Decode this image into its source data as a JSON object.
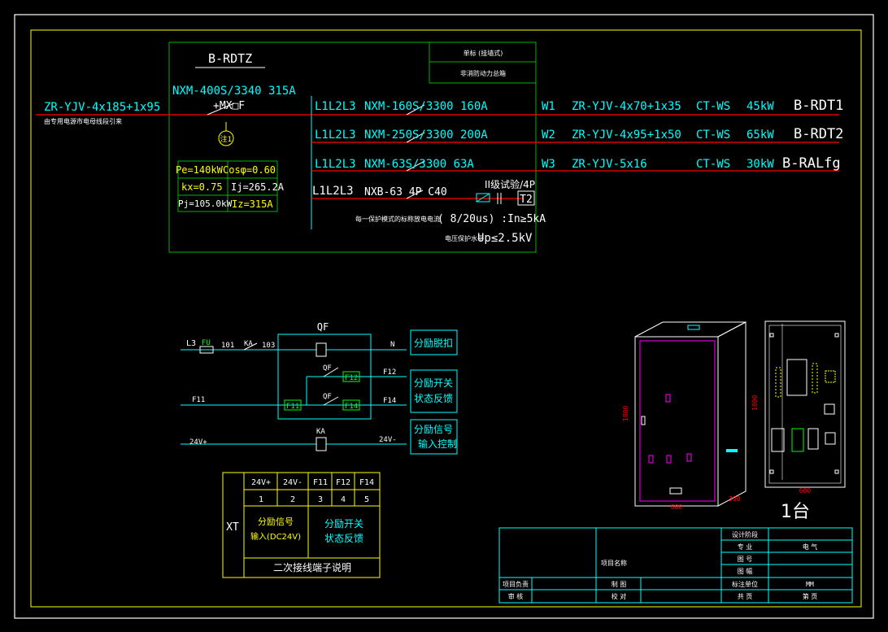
{
  "panel": {
    "name": "B-RDTZ",
    "mode_label1": "单标 (挂墙式)",
    "mode_label2": "非消防动力总箱"
  },
  "incoming": {
    "cable": "ZR-YJV-4x185+1x95",
    "source": "由专用电源市电母线段引来",
    "breaker": "NXM-400S/3340 315A",
    "shunt": "+MX□F",
    "note": "注1"
  },
  "calc": {
    "pe": "Pe=140kW",
    "cos": "Cosφ=0.60",
    "kx": "kx=0.75",
    "ij": "Ij=265.2A",
    "pj": "Pj=105.0kW",
    "iz": "Iz=315A"
  },
  "outgoing": [
    {
      "phase": "L1L2L3",
      "breaker": "NXM-160S/3300 160A",
      "circuit": "W1",
      "cable": "ZR-YJV-4x70+1x35",
      "lay": "CT-WS",
      "power": "45kW",
      "dest": "B-RDT1"
    },
    {
      "phase": "L1L2L3",
      "breaker": "NXM-250S/3300 200A",
      "circuit": "W2",
      "cable": "ZR-YJV-4x95+1x50",
      "lay": "CT-WS",
      "power": "65kW",
      "dest": "B-RDT2"
    },
    {
      "phase": "L1L2L3",
      "breaker": "NXM-63S/3300 63A",
      "circuit": "W3",
      "cable": "ZR-YJV-5x16",
      "lay": "CT-WS",
      "power": "30kW",
      "dest": "B-RALfg"
    }
  ],
  "spd": {
    "phase": "L1L2L3",
    "breaker": "NXB-63 4P C40",
    "class": "II级试验/4P",
    "tag": "T2",
    "line1_cn": "每一保护模式的标称放电电流",
    "line1": "( 8/20us) :In≥5kA",
    "line2_cn": "电压保护水平",
    "line2": "Up≤2.5kV"
  },
  "control": {
    "qf": "QF",
    "l3": "L3",
    "fu": "FU",
    "n101": "101",
    "ka": "KA",
    "n103": "103",
    "n": "N",
    "f12": "F12",
    "f14": "F14",
    "f11": "F11",
    "qf2": "QF",
    "qf3": "QF",
    "ka2": "KA",
    "v24p": "24V+",
    "v24m": "24V-",
    "box1": "分励脱扣",
    "box2a": "分励开关",
    "box2b": "状态反馈",
    "box3a": "分励信号",
    "box3b": "输入控制"
  },
  "terminal": {
    "xt": "XT",
    "headers": [
      "24V+",
      "24V-",
      "F11",
      "F12",
      "F14"
    ],
    "numbers": [
      "1",
      "2",
      "3",
      "4",
      "5"
    ],
    "sig1": "分励信号",
    "sig2": "输入(DC24V)",
    "fb1": "分励开关",
    "fb2": "状态反馈",
    "caption": "二次接线端子说明"
  },
  "cabinet": {
    "h1": "1800",
    "w1": "600",
    "d1": "300",
    "h2": "1800",
    "w2": "600",
    "qty": "1台"
  },
  "titleblock": {
    "design_stage": "设计阶段",
    "major": "专  业",
    "major_val": "电  气",
    "drawing_no": "图  号",
    "scale": "图  幅",
    "project_name": "项目名称",
    "proj_lead": "项目负责",
    "drawn": "制  图",
    "unit": "标注单位",
    "unit_val": "MM",
    "review": "审  核",
    "check": "校  对",
    "total": "共  页",
    "page": "第  页"
  },
  "colors": {
    "green": "#00b400",
    "cyan": "#00ffff",
    "red": "#ff0000",
    "white": "#ffffff",
    "yellow": "#ffff00",
    "magenta": "#ff00ff"
  }
}
